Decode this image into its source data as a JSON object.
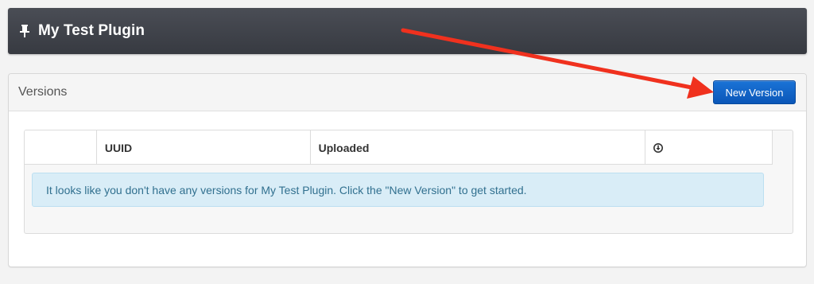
{
  "header": {
    "title": "My Test Plugin",
    "icon": "pin-icon"
  },
  "versions_panel": {
    "title": "Versions",
    "new_version_label": "New Version",
    "button_color": "#0b57b8",
    "table": {
      "columns": [
        "",
        "UUID",
        "Uploaded",
        ""
      ],
      "download_icon": "download-icon"
    },
    "empty_message": "It looks like you don't have any versions for My Test Plugin. Click the \"New Version\" to get started."
  },
  "annotation": {
    "type": "arrow",
    "color": "#f0311e",
    "points_to": "new-version-button"
  }
}
